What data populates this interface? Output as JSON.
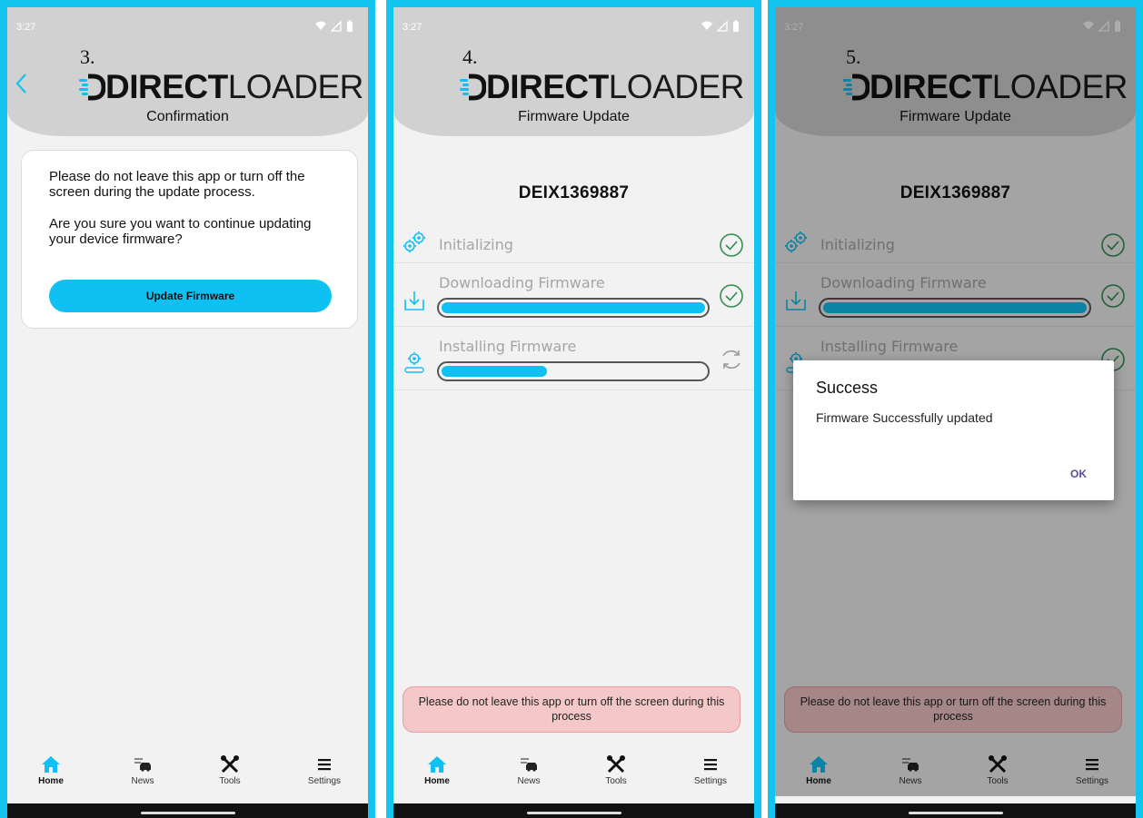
{
  "status_bar": {
    "time": "3:27"
  },
  "logo": {
    "bold": "DIRECT",
    "thin": "LOADER"
  },
  "screens": [
    {
      "step": "3.",
      "subtitle": "Confirmation",
      "card": {
        "warning_text": "Please do not leave this app or turn off the screen during the update process.",
        "question_text": "Are you sure you want to continue updating your device firmware?",
        "button_label": "Update Firmware"
      }
    },
    {
      "step": "4.",
      "subtitle": "Firmware Update",
      "device_id": "DEIX1369887",
      "steps": [
        {
          "label": "Initializing",
          "status": "done",
          "icon": "gears-icon"
        },
        {
          "label": "Downloading Firmware",
          "status": "done",
          "icon": "download-icon",
          "progress": 1.0
        },
        {
          "label": "Installing Firmware",
          "status": "in-progress",
          "icon": "install-gear-icon",
          "progress": 0.4
        }
      ],
      "warning": "Please do not leave this app or turn off the screen during this process"
    },
    {
      "step": "5.",
      "subtitle": "Firmware Update",
      "device_id": "DEIX1369887",
      "steps": [
        {
          "label": "Initializing",
          "status": "done",
          "icon": "gears-icon"
        },
        {
          "label": "Downloading Firmware",
          "status": "done",
          "icon": "download-icon",
          "progress": 1.0
        },
        {
          "label": "Installing Firmware",
          "status": "done",
          "icon": "install-gear-icon"
        }
      ],
      "warning": "Please do not leave this app or turn off the screen during this process",
      "dialog": {
        "title": "Success",
        "message": "Firmware Successfully updated",
        "ok_label": "OK"
      }
    }
  ],
  "tabs": [
    {
      "label": "Home",
      "icon": "home-icon",
      "active": true
    },
    {
      "label": "News",
      "icon": "news-icon"
    },
    {
      "label": "Tools",
      "icon": "tools-icon"
    },
    {
      "label": "Settings",
      "icon": "menu-icon"
    }
  ],
  "colors": {
    "frame": "#12c4ee",
    "accent": "#0fc1f2",
    "header": "#d1d1d1",
    "warning_bg": "#f4c7c9",
    "check_green": "#2f8f4e",
    "dialog_button": "#5b4b9a"
  }
}
